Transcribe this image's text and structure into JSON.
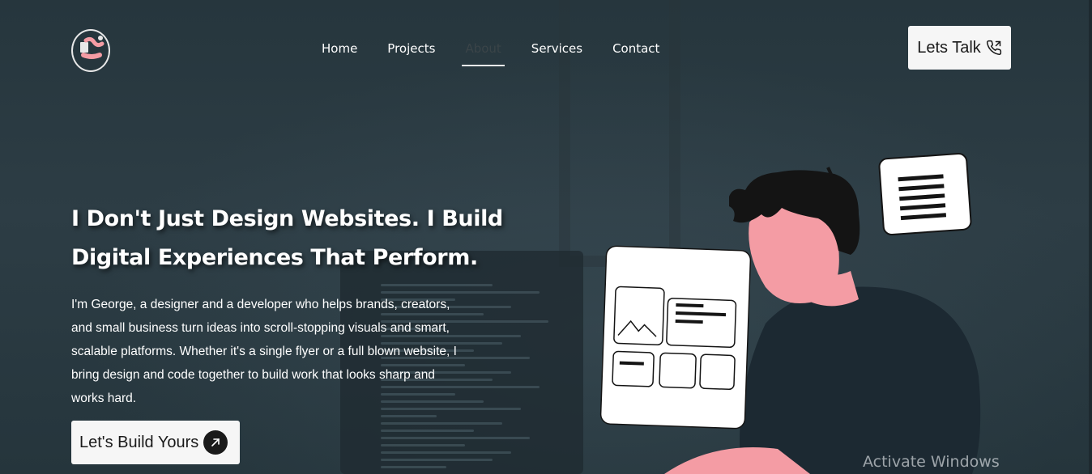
{
  "nav": {
    "items": [
      {
        "label": "Home",
        "active": false
      },
      {
        "label": "Projects",
        "active": false
      },
      {
        "label": "About",
        "active": true
      },
      {
        "label": "Services",
        "active": false
      },
      {
        "label": "Contact",
        "active": false
      }
    ]
  },
  "header": {
    "cta_label": "Lets Talk",
    "cta_icon": "phone-call-icon",
    "logo_icon": "logo-avatar-icon"
  },
  "hero": {
    "headline_line1": "I Don't Just Design Websites. I Build",
    "headline_line2": "Digital Experiences That Perform.",
    "bio_lines": [
      "I'm George, a designer and a developer who helps brands, creators,",
      "and small business turn ideas into scroll-stopping visuals and smart,",
      "scalable platforms. Whether it's a single flyer or a full blown website, I",
      "bring design and code together to build work that looks sharp and",
      "works hard."
    ],
    "cta_label": "Let's Build Yours",
    "cta_icon": "arrow-up-right-icon"
  },
  "os_overlay": {
    "watermark": "Activate Windows"
  },
  "colors": {
    "background": "#2a3a42",
    "accent_pink": "#f49ca4",
    "button_bg": "#f6f6f6",
    "dark": "#1a1a1a"
  }
}
